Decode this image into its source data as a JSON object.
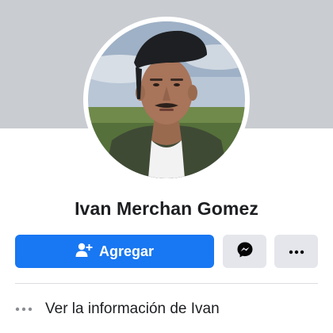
{
  "profile": {
    "name": "Ivan Merchan Gomez",
    "avatar_icon": "profile-photo",
    "cover_color": "#c9ccd1"
  },
  "actions": {
    "add_label": "Agregar",
    "add_icon": "add-friend-icon",
    "message_icon": "messenger-icon",
    "more_icon": "more-icon",
    "accent": "#1877f2",
    "secondary_bg": "#e4e6eb"
  },
  "info": {
    "icon": "more-dots-icon",
    "label": "Ver la información de Ivan"
  }
}
